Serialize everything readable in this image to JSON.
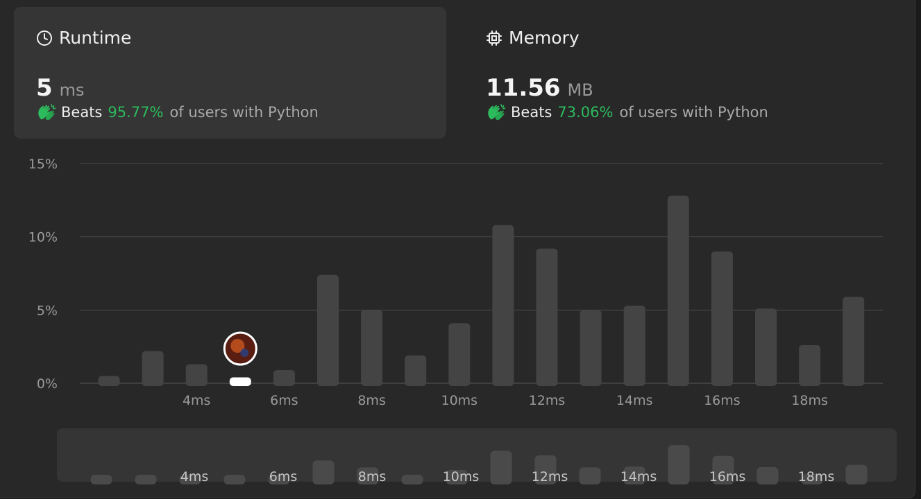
{
  "runtime": {
    "title": "Runtime",
    "value": "5",
    "unit": "ms",
    "beats_label": "Beats",
    "beats_percent": "95.77%",
    "beats_suffix": "of users with Python"
  },
  "memory": {
    "title": "Memory",
    "value": "11.56",
    "unit": "MB",
    "beats_label": "Beats",
    "beats_percent": "73.06%",
    "beats_suffix": "of users with Python"
  },
  "colors": {
    "accent_green": "#2cbb5d",
    "bar": "#444444",
    "highlight_bar": "#ffffff"
  },
  "chart_data": {
    "type": "bar",
    "title": "",
    "xlabel": "",
    "ylabel": "",
    "ylim": [
      0,
      15
    ],
    "y_ticks": [
      "15%",
      "10%",
      "5%",
      "0%"
    ],
    "y_tick_values": [
      15,
      10,
      5,
      0
    ],
    "x_tick_labels": [
      "4ms",
      "6ms",
      "8ms",
      "10ms",
      "12ms",
      "14ms",
      "16ms",
      "18ms"
    ],
    "x_tick_values": [
      4,
      6,
      8,
      10,
      12,
      14,
      16,
      18
    ],
    "x": [
      1,
      2,
      3,
      4,
      5,
      6,
      7,
      8,
      9,
      10,
      11,
      12,
      13,
      14,
      15,
      16,
      17,
      18,
      19
    ],
    "values": [
      0.5,
      2.2,
      1.3,
      0.4,
      0.9,
      7.4,
      5.0,
      1.9,
      4.1,
      10.8,
      9.2,
      5.0,
      5.3,
      12.8,
      9.0,
      5.1,
      2.6,
      5.9
    ],
    "values_x": [
      2,
      3,
      4,
      5,
      6,
      7,
      8,
      9,
      10,
      11,
      12,
      13,
      14,
      15,
      16,
      17,
      18,
      19
    ],
    "highlight_x": 5,
    "grid": true,
    "legend": "none",
    "navigator": {
      "x_tick_labels": [
        "4ms",
        "6ms",
        "8ms",
        "10ms",
        "12ms",
        "14ms",
        "16ms",
        "18ms"
      ]
    }
  }
}
